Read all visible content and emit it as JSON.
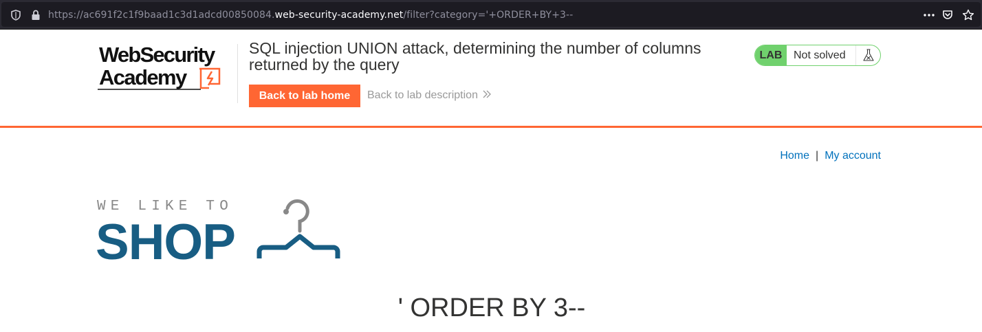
{
  "browser": {
    "url_prefix": "https://ac691f2c1f9baad1c3d1adcd00850084.",
    "url_domain": "web-security-academy.net",
    "url_path": "/filter?category='+ORDER+BY+3--",
    "icons": [
      "shield-icon",
      "lock-icon",
      "more-icon",
      "pocket-icon",
      "star-icon"
    ]
  },
  "academy": {
    "logo_line1": "WebSecurity",
    "logo_line2": "Academy",
    "lab_title": "SQL injection UNION attack, determining the number of columns returned by the query",
    "back_home_label": "Back to lab home",
    "back_description_label": "Back to lab description",
    "status_badge": "LAB",
    "status_text": "Not solved",
    "colors": {
      "accent": "#ff6633",
      "status_green": "#70d16d",
      "link_blue": "#0071bc"
    }
  },
  "shop": {
    "nav": {
      "home": "Home",
      "separator": "|",
      "account": "My account"
    },
    "logo_tagline": "WE LIKE TO",
    "logo_word": "SHOP",
    "heading": "' ORDER BY 3--"
  }
}
